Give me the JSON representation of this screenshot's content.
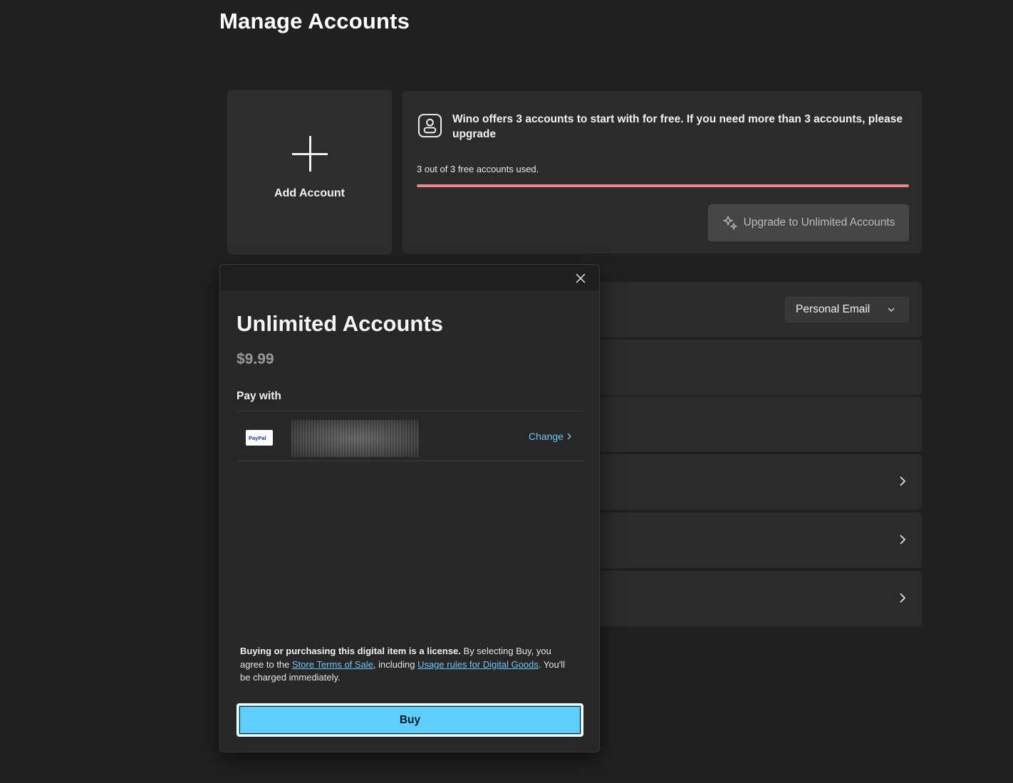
{
  "page": {
    "title": "Manage Accounts"
  },
  "add_account": {
    "label": "Add Account",
    "icon": "plus-icon"
  },
  "free_accounts": {
    "icon": "account-icon",
    "message": "Wino offers 3 accounts to start with for free. If you need more than 3 accounts, please upgrade",
    "usage_text": "3 out of 3 free accounts used.",
    "used": 3,
    "limit": 3,
    "progress_color": "#f08890",
    "upgrade_button": {
      "icon": "sparkle-icon",
      "label": "Upgrade to Unlimited Accounts"
    }
  },
  "settings_rows": {
    "dropdown_value": "Personal Email",
    "chevron_icon": "chevron-right-icon"
  },
  "purchase_dialog": {
    "title": "Unlimited Accounts",
    "price": "$9.99",
    "pay_with_label": "Pay with",
    "payment_method": {
      "icon": "paypal-logo",
      "logo_text": "PayPal",
      "change_label": "Change"
    },
    "legal": {
      "bold": "Buying or purchasing this digital item is a license.",
      "text1": " By selecting Buy, you agree to the ",
      "link1": "Store Terms of Sale",
      "text2": ", including ",
      "link2": "Usage rules for Digital Goods",
      "text3": ". You'll be charged immediately."
    },
    "buy_label": "Buy",
    "accent_color": "#60cdff"
  }
}
